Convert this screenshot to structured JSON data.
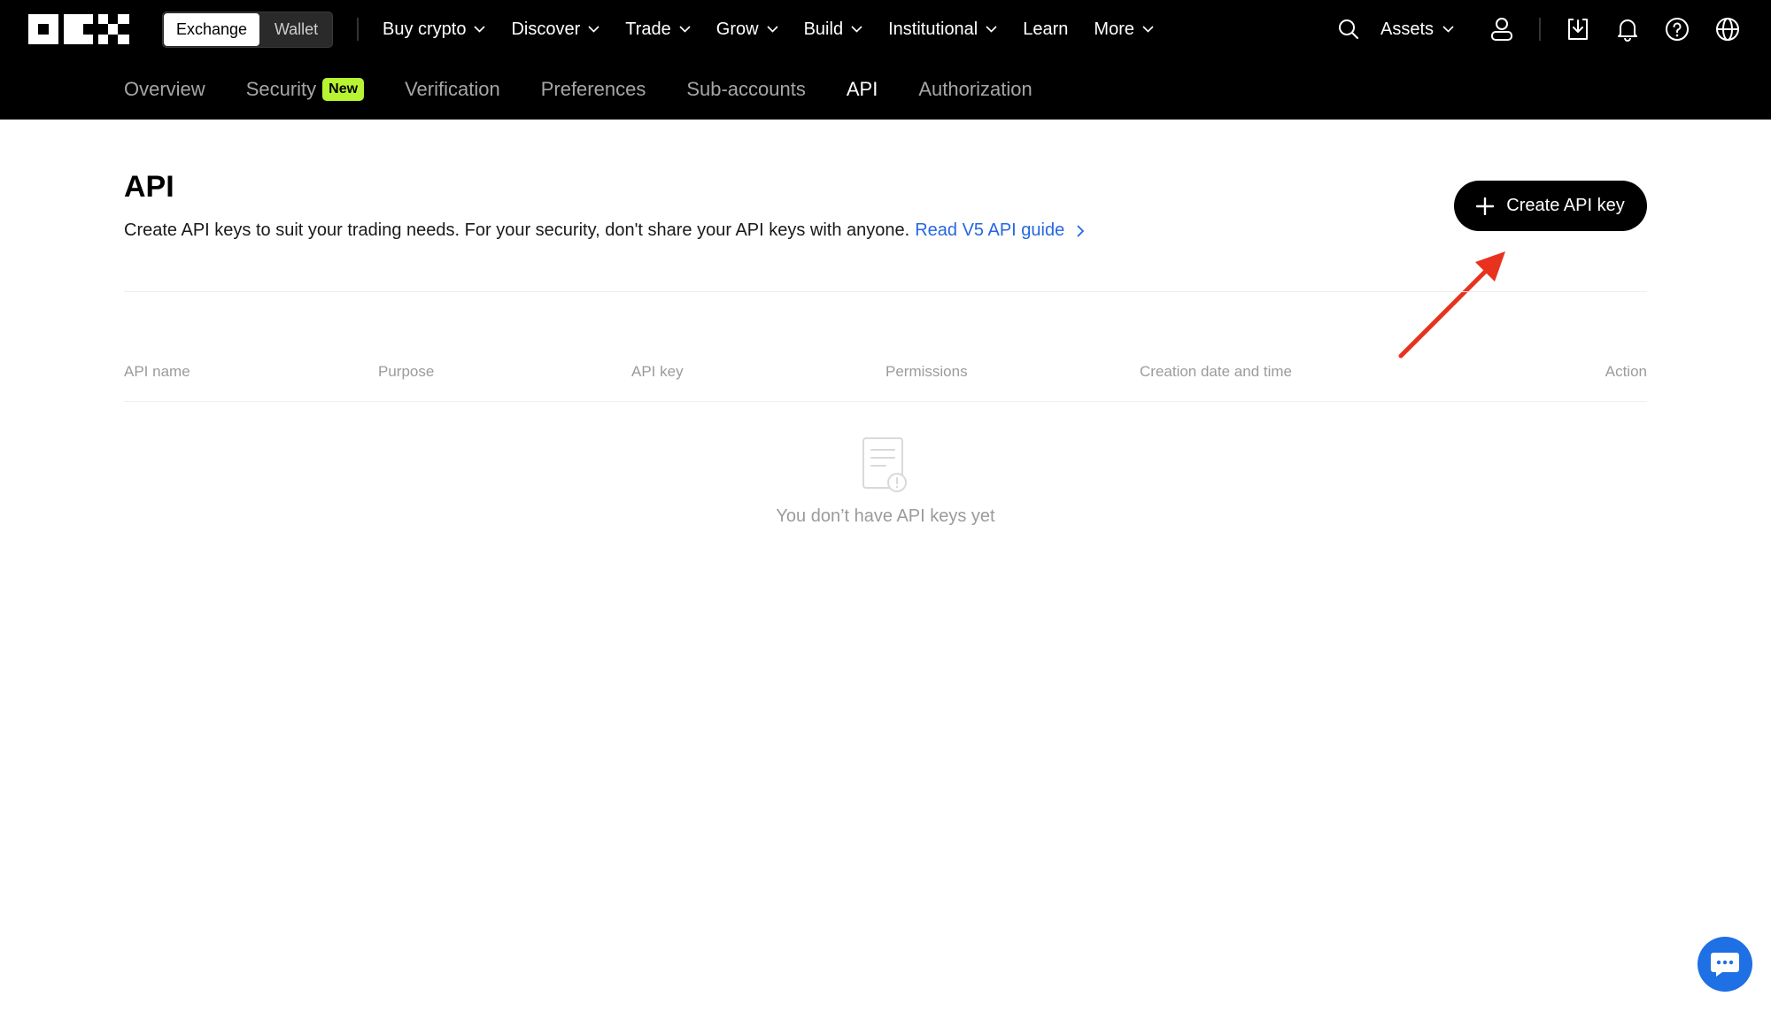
{
  "header": {
    "mode_toggle": {
      "exchange_label": "Exchange",
      "wallet_label": "Wallet",
      "selected": "Exchange"
    },
    "menu": [
      {
        "label": "Buy crypto",
        "has_dropdown": true
      },
      {
        "label": "Discover",
        "has_dropdown": true
      },
      {
        "label": "Trade",
        "has_dropdown": true
      },
      {
        "label": "Grow",
        "has_dropdown": true
      },
      {
        "label": "Build",
        "has_dropdown": true
      },
      {
        "label": "Institutional",
        "has_dropdown": true
      },
      {
        "label": "Learn",
        "has_dropdown": false
      },
      {
        "label": "More",
        "has_dropdown": true
      }
    ],
    "assets_label": "Assets",
    "icons": [
      "search-icon",
      "user-icon",
      "download-icon",
      "bell-icon",
      "help-icon",
      "globe-icon"
    ]
  },
  "subnav": {
    "tabs": [
      {
        "label": "Overview"
      },
      {
        "label": "Security",
        "badge": "New"
      },
      {
        "label": "Verification"
      },
      {
        "label": "Preferences"
      },
      {
        "label": "Sub-accounts"
      },
      {
        "label": "API",
        "active": true
      },
      {
        "label": "Authorization"
      }
    ]
  },
  "main": {
    "title": "API",
    "description": "Create API keys to suit your trading needs. For your security, don't share your API keys with anyone.",
    "guide_link": "Read V5 API guide",
    "create_button": "Create API key",
    "table": {
      "columns": [
        "API name",
        "Purpose",
        "API key",
        "Permissions",
        "Creation date and time",
        "Action"
      ],
      "rows": [],
      "empty_text": "You don’t have API keys yet"
    }
  },
  "colors": {
    "header_bg": "#000000",
    "link": "#2667e0",
    "badge_bg": "#b7f432",
    "chat_button": "#1f6fe5",
    "annotation_arrow": "#e8321e"
  }
}
